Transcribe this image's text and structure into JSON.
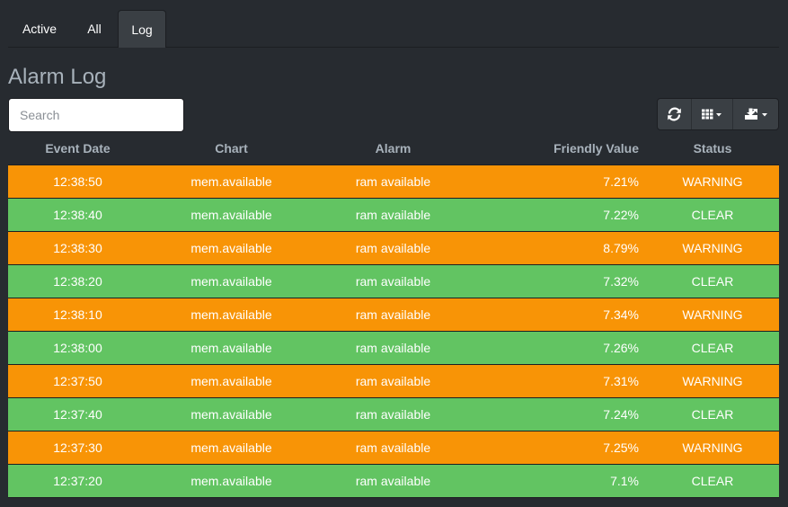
{
  "tabs": [
    {
      "label": "Active"
    },
    {
      "label": "All"
    },
    {
      "label": "Log",
      "active": true
    }
  ],
  "page": {
    "title": "Alarm Log"
  },
  "search": {
    "placeholder": "Search",
    "value": ""
  },
  "toolbar": {
    "refresh_icon": "refresh-icon",
    "columns_icon": "columns-grid-icon",
    "export_icon": "export-icon"
  },
  "table": {
    "headers": {
      "date": "Event Date",
      "chart": "Chart",
      "alarm": "Alarm",
      "value": "Friendly Value",
      "status": "Status"
    },
    "rows": [
      {
        "date": "12:38:50",
        "chart": "mem.available",
        "alarm": "ram available",
        "value": "7.21%",
        "status": "WARNING"
      },
      {
        "date": "12:38:40",
        "chart": "mem.available",
        "alarm": "ram available",
        "value": "7.22%",
        "status": "CLEAR"
      },
      {
        "date": "12:38:30",
        "chart": "mem.available",
        "alarm": "ram available",
        "value": "8.79%",
        "status": "WARNING"
      },
      {
        "date": "12:38:20",
        "chart": "mem.available",
        "alarm": "ram available",
        "value": "7.32%",
        "status": "CLEAR"
      },
      {
        "date": "12:38:10",
        "chart": "mem.available",
        "alarm": "ram available",
        "value": "7.34%",
        "status": "WARNING"
      },
      {
        "date": "12:38:00",
        "chart": "mem.available",
        "alarm": "ram available",
        "value": "7.26%",
        "status": "CLEAR"
      },
      {
        "date": "12:37:50",
        "chart": "mem.available",
        "alarm": "ram available",
        "value": "7.31%",
        "status": "WARNING"
      },
      {
        "date": "12:37:40",
        "chart": "mem.available",
        "alarm": "ram available",
        "value": "7.24%",
        "status": "CLEAR"
      },
      {
        "date": "12:37:30",
        "chart": "mem.available",
        "alarm": "ram available",
        "value": "7.25%",
        "status": "WARNING"
      },
      {
        "date": "12:37:20",
        "chart": "mem.available",
        "alarm": "ram available",
        "value": "7.1%",
        "status": "CLEAR"
      }
    ]
  },
  "colors": {
    "background": "#272b30",
    "warning": "#f89406",
    "clear": "#62c462",
    "header_text": "#a8b2bb"
  }
}
